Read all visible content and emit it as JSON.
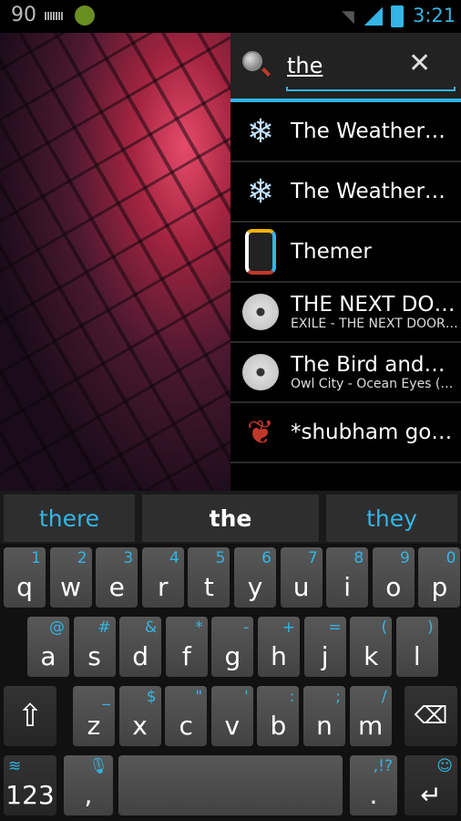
{
  "status": {
    "left_number": "90",
    "time": "3:21",
    "colors": {
      "accent": "#33b5e5"
    },
    "icons": [
      "keyboard-icon",
      "bug-icon",
      "wifi-icon",
      "signal-icon",
      "battery-charging-icon"
    ]
  },
  "search": {
    "query": "the",
    "clear_icon": "close-icon"
  },
  "results": [
    {
      "icon": "snowflake-icon",
      "title": "The Weather…"
    },
    {
      "icon": "snowflake-icon",
      "title": "The Weather…"
    },
    {
      "icon": "themer-icon",
      "title": "Themer"
    },
    {
      "icon": "disc-icon",
      "title": "THE NEXT DO…",
      "subtitle": "EXILE - THE NEXT DOOR…"
    },
    {
      "icon": "disc-icon",
      "title": "The Bird and…",
      "subtitle": "Owl City - Ocean Eyes (…"
    },
    {
      "icon": "hearts-icon",
      "title": "*shubham go…"
    }
  ],
  "keyboard": {
    "suggestions": [
      "there",
      "the",
      "they"
    ],
    "row1": [
      [
        "q",
        "1"
      ],
      [
        "w",
        "2"
      ],
      [
        "e",
        "3"
      ],
      [
        "r",
        "4"
      ],
      [
        "t",
        "5"
      ],
      [
        "y",
        "6"
      ],
      [
        "u",
        "7"
      ],
      [
        "i",
        "8"
      ],
      [
        "o",
        "9"
      ],
      [
        "p",
        "0"
      ]
    ],
    "row2": [
      [
        "a",
        "@"
      ],
      [
        "s",
        "#"
      ],
      [
        "d",
        "&"
      ],
      [
        "f",
        "*"
      ],
      [
        "g",
        "-"
      ],
      [
        "h",
        "+"
      ],
      [
        "j",
        "="
      ],
      [
        "k",
        "("
      ],
      [
        "l",
        ")"
      ]
    ],
    "row3": [
      [
        "z",
        "_"
      ],
      [
        "x",
        "$"
      ],
      [
        "c",
        "\""
      ],
      [
        "v",
        "'"
      ],
      [
        "b",
        ":"
      ],
      [
        "n",
        ";"
      ],
      [
        "m",
        "/"
      ]
    ],
    "symbols_label": "123",
    "comma": ",",
    "period": ".",
    "period_hint": ",!?"
  }
}
